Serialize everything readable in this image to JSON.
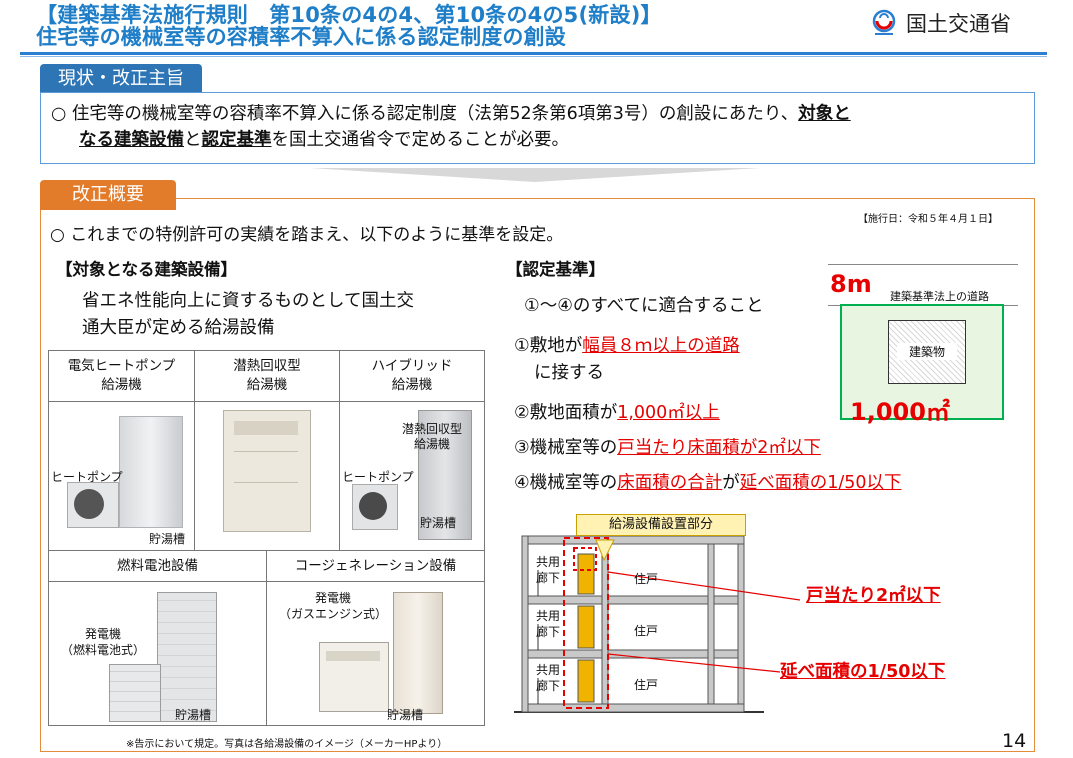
{
  "header": {
    "title_line1": "【建築基準法施行規則　第10条の4の4、第10条の4の5(新設)】",
    "title_line2": "住宅等の機械室等の容積率不算入に係る認定制度の創設",
    "ministry": "国土交通省"
  },
  "section1": {
    "tab": "現状・改正主旨",
    "bullet": "○",
    "text_a": "住宅等の機械室等の容積率不算入に係る認定制度（法第52条第6項第3号）の創設にあたり、",
    "bold_a": "対象と",
    "bold_b": "なる建築設備",
    "text_b": "と",
    "bold_c": "認定基準",
    "text_c": "を国土交通省令で定めることが必要。"
  },
  "section2": {
    "tab": "改正概要",
    "effective": "【施行日：令和５年４月１日】",
    "intro": "○ これまでの特例許可の実績を踏まえ、以下のように基準を設定。",
    "left_heading": "【対象となる建築設備】",
    "left_desc1": "省エネ性能向上に資するものとして国土交",
    "left_desc2": "通大臣が定める給湯設備",
    "equipment": {
      "col1": "電気ヒートポンプ\n給湯機",
      "col2": "潜熱回収型\n給湯機",
      "col3": "ハイブリッド\n給湯機",
      "fuel": "燃料電池設備",
      "cogen": "コージェネレーション設備",
      "heat_pump": "ヒートポンプ",
      "storage": "貯湯槽",
      "latent": "潜熱回収型\n給湯機",
      "generator_fc": "発電機\n（燃料電池式）",
      "generator_gas": "発電機\n（ガスエンジン式）"
    },
    "footnote": "※告示において規定。写真は各給湯設備のイメージ（メーカーHPより）",
    "right_heading": "【認定基準】",
    "criteria_all": "①～④のすべてに適合すること",
    "c1_a": "①敷地が",
    "c1_red": "幅員８ｍ以上の道路",
    "c1_b": "に接する",
    "c2_a": "②敷地面積が",
    "c2_red": "1,000㎡以上",
    "c3_a": "③機械室等の",
    "c3_red": "戸当たり床面積が2㎡以下",
    "c4_a": "④機械室等の",
    "c4_red1": "床面積の合計",
    "c4_mid": "が",
    "c4_red2": "延べ面積の1/50以下",
    "site": {
      "road_width": "8m",
      "road_label": "建築基準法上の道路",
      "building": "建築物",
      "area": "1,000㎡"
    },
    "section_diagram": {
      "callout": "給湯設備設置部分",
      "corridor": "共用\n廊下",
      "dwelling": "住戸",
      "ann1": "戸当たり2㎡以下",
      "ann2": "延べ面積の1/50以下"
    }
  },
  "page_number": "14",
  "colors": {
    "title_blue": "#1f7ec8",
    "tab_blue": "#2e75b6",
    "tab_orange": "#e27b2a",
    "red": "#e60000",
    "green": "#00b050",
    "yellow": "#f0b400"
  }
}
